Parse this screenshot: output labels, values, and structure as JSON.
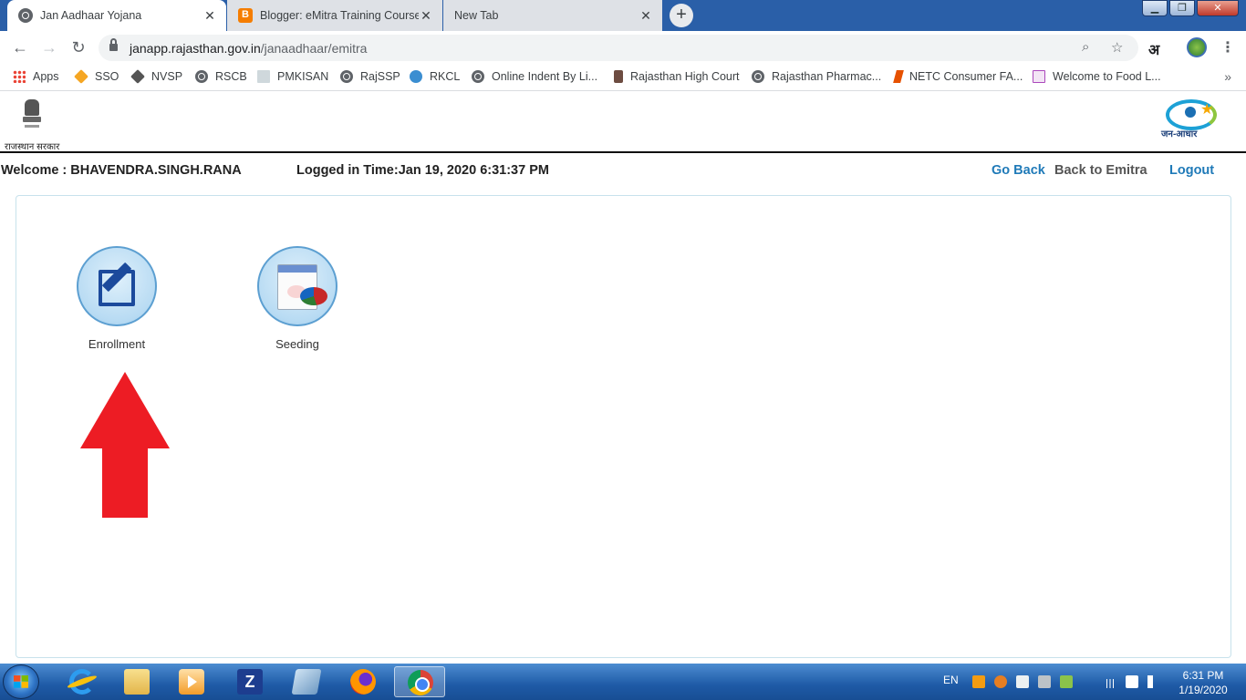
{
  "browser": {
    "tabs": [
      {
        "label": "Jan Aadhaar Yojana",
        "active": true,
        "icon": "globe-icon"
      },
      {
        "label": "Blogger: eMitra Training Course",
        "active": false,
        "icon": "blogger-icon"
      },
      {
        "label": "New Tab",
        "active": false,
        "icon": ""
      }
    ],
    "url_host": "janapp.rajasthan.gov.in",
    "url_path": "/janaadhaar/emitra",
    "ext_label": "अ",
    "bookmarks": [
      {
        "label": "Apps",
        "icon": "apps-icon"
      },
      {
        "label": "SSO",
        "icon": "sso-icon"
      },
      {
        "label": "NVSP",
        "icon": "nvsp-icon"
      },
      {
        "label": "RSCB",
        "icon": "globe-icon"
      },
      {
        "label": "PMKISAN",
        "icon": "document-icon"
      },
      {
        "label": "RajSSP",
        "icon": "globe-icon"
      },
      {
        "label": "RKCL",
        "icon": "rkcl-icon"
      },
      {
        "label": "Online Indent By Li...",
        "icon": "globe-icon"
      },
      {
        "label": "Rajasthan High Court",
        "icon": "court-icon"
      },
      {
        "label": "Rajasthan Pharmac...",
        "icon": "globe-icon"
      },
      {
        "label": "NETC Consumer FA...",
        "icon": "netc-icon"
      },
      {
        "label": "Welcome to Food L...",
        "icon": "food-icon"
      }
    ],
    "more": "»"
  },
  "header": {
    "gov_label": "राजस्थान सरकार",
    "logo_label": "जन-आधार"
  },
  "info": {
    "welcome": "Welcome : BHAVENDRA.SINGH.RANA",
    "login_time": "Logged in Time:Jan 19, 2020 6:31:37 PM",
    "go_back": "Go Back",
    "back_to_emitra": "Back to Emitra",
    "logout": "Logout"
  },
  "tiles": [
    {
      "label": "Enrollment",
      "icon": "edit-icon"
    },
    {
      "label": "Seeding",
      "icon": "chart-window-icon"
    }
  ],
  "annotation": {
    "arrow_color": "#ed1c24",
    "points_to": "Enrollment"
  },
  "taskbar": {
    "lang": "EN",
    "time": "6:31 PM",
    "date": "1/19/2020"
  },
  "colors": {
    "link_blue": "#1f7ab8",
    "taskbar": "#1e5aa6",
    "tab_strip": "#2a5fa8"
  }
}
